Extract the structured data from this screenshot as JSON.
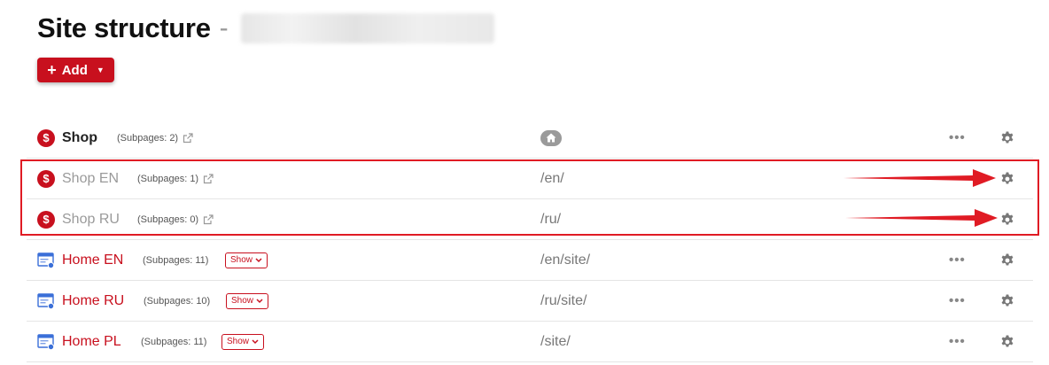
{
  "header": {
    "title": "Site structure",
    "separator": "-",
    "add_button": {
      "label": "Add",
      "plus": "+",
      "caret": "▼"
    }
  },
  "colors": {
    "brand_red": "#c8101e",
    "highlight_red": "#e01b24",
    "muted": "#9a9a9a"
  },
  "rows": [
    {
      "name": "Shop",
      "subpages": "(Subpages: 2)",
      "url": "",
      "icon": "shop-icon",
      "style": "bold",
      "home": true,
      "show_label": "",
      "more": "•••"
    },
    {
      "name": "Shop EN",
      "subpages": "(Subpages: 1)",
      "url": "/en/",
      "icon": "shop-icon",
      "style": "muted",
      "home": false,
      "show_label": "",
      "more": ""
    },
    {
      "name": "Shop RU",
      "subpages": "(Subpages: 0)",
      "url": "/ru/",
      "icon": "shop-icon",
      "style": "muted",
      "home": false,
      "show_label": "",
      "more": ""
    },
    {
      "name": "Home EN",
      "subpages": "(Subpages: 11)",
      "url": "/en/site/",
      "icon": "page-icon",
      "style": "red",
      "home": false,
      "show_label": "Show",
      "more": "•••"
    },
    {
      "name": "Home RU",
      "subpages": "(Subpages: 10)",
      "url": "/ru/site/",
      "icon": "page-icon",
      "style": "red",
      "home": false,
      "show_label": "Show",
      "more": "•••"
    },
    {
      "name": "Home PL",
      "subpages": "(Subpages: 11)",
      "url": "/site/",
      "icon": "page-icon",
      "style": "red",
      "home": false,
      "show_label": "Show",
      "more": "•••"
    }
  ]
}
